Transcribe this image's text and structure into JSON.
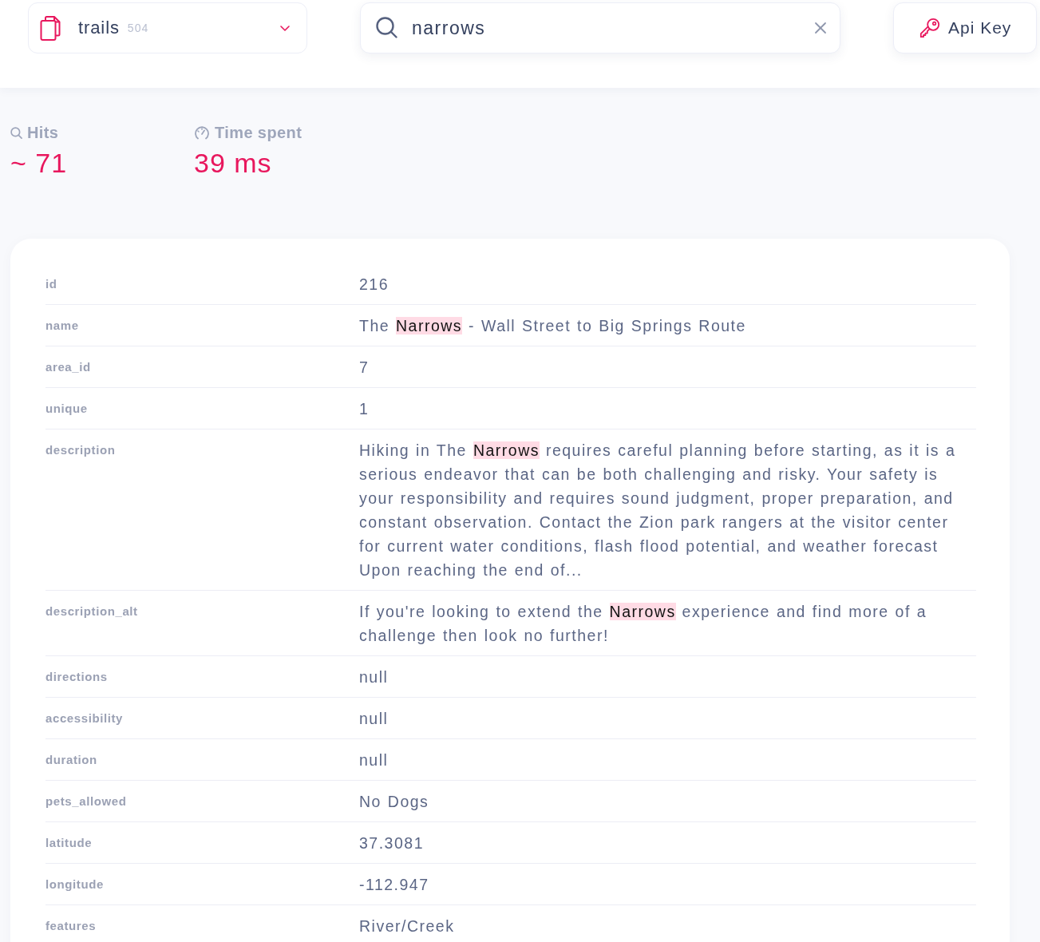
{
  "collection_selector": {
    "name": "trails",
    "count": "504"
  },
  "search": {
    "value": "narrows"
  },
  "api_key_button": {
    "label": "Api Key"
  },
  "stats": [
    {
      "kind": "hits",
      "label": "Hits",
      "value": "~ 71"
    },
    {
      "kind": "time",
      "label": "Time spent",
      "value": "39 ms"
    }
  ],
  "document": {
    "rows": [
      {
        "field": "id",
        "parts": [
          {
            "text": "216",
            "highlighted": false
          }
        ]
      },
      {
        "field": "name",
        "parts": [
          {
            "text": "The ",
            "highlighted": false
          },
          {
            "text": "Narrows",
            "highlighted": true
          },
          {
            "text": " - Wall Street to Big Springs Route",
            "highlighted": false
          }
        ]
      },
      {
        "field": "area_id",
        "parts": [
          {
            "text": "7",
            "highlighted": false
          }
        ]
      },
      {
        "field": "unique",
        "parts": [
          {
            "text": "1",
            "highlighted": false
          }
        ]
      },
      {
        "field": "description",
        "parts": [
          {
            "text": "Hiking in The ",
            "highlighted": false
          },
          {
            "text": "Narrows",
            "highlighted": true
          },
          {
            "text": " requires careful planning before starting, as it is a serious endeavor that can be both challenging and risky. Your safety is your responsibility and requires sound judgment, proper preparation, and constant observation. Contact the Zion park rangers at the visitor center for current water conditions, flash flood potential, and weather forecast Upon reaching the end of...",
            "highlighted": false
          }
        ]
      },
      {
        "field": "description_alt",
        "parts": [
          {
            "text": "If you're looking to extend the ",
            "highlighted": false
          },
          {
            "text": "Narrows",
            "highlighted": true
          },
          {
            "text": " experience and find more of a challenge then look no further!",
            "highlighted": false
          }
        ]
      },
      {
        "field": "directions",
        "parts": [
          {
            "text": "null",
            "highlighted": false
          }
        ]
      },
      {
        "field": "accessibility",
        "parts": [
          {
            "text": "null",
            "highlighted": false
          }
        ]
      },
      {
        "field": "duration",
        "parts": [
          {
            "text": "null",
            "highlighted": false
          }
        ]
      },
      {
        "field": "pets_allowed",
        "parts": [
          {
            "text": "No Dogs",
            "highlighted": false
          }
        ]
      },
      {
        "field": "latitude",
        "parts": [
          {
            "text": "37.3081",
            "highlighted": false
          }
        ]
      },
      {
        "field": "longitude",
        "parts": [
          {
            "text": "-112.947",
            "highlighted": false
          }
        ]
      },
      {
        "field": "features",
        "parts": [
          {
            "text": "River/Creek",
            "highlighted": false
          }
        ]
      }
    ]
  }
}
